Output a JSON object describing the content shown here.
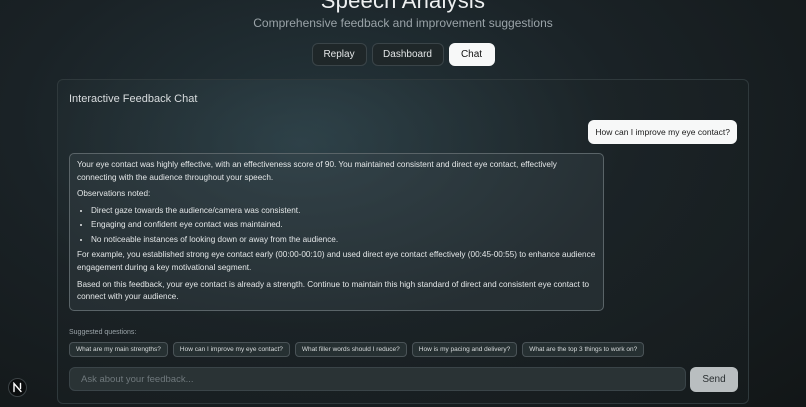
{
  "header": {
    "title": "Speech Analysis",
    "subtitle": "Comprehensive feedback and improvement suggestions"
  },
  "tabs": [
    {
      "label": "Replay",
      "active": false
    },
    {
      "label": "Dashboard",
      "active": false
    },
    {
      "label": "Chat",
      "active": true
    }
  ],
  "panel": {
    "title": "Interactive Feedback Chat",
    "user_message": "How can I improve my eye contact?",
    "assistant_message": {
      "p1": "Your eye contact was highly effective, with an effectiveness score of 90. You maintained consistent and direct eye contact, effectively connecting with the audience throughout your speech.",
      "p2": "Observations noted:",
      "bullets": [
        "Direct gaze towards the audience/camera was consistent.",
        "Engaging and confident eye contact was maintained.",
        "No noticeable instances of looking down or away from the audience."
      ],
      "p3": "For example, you established strong eye contact early (00:00-00:10) and used direct eye contact effectively (00:45-00:55) to enhance audience engagement during a key motivational segment.",
      "p4": "Based on this feedback, your eye contact is already a strength. Continue to maintain this high standard of direct and consistent eye contact to connect with your audience."
    },
    "suggested_label": "Suggested questions:",
    "suggestions": [
      "What are my main strengths?",
      "How can I improve my eye contact?",
      "What filler words should I reduce?",
      "How is my pacing and delivery?",
      "What are the top 3 things to work on?"
    ],
    "input_placeholder": "Ask about your feedback...",
    "send_label": "Send"
  },
  "logo": {
    "letter": "N"
  },
  "colors": {
    "background": "#121617",
    "active_tab": "#f7f8f8",
    "send_button": "#b9bec0"
  }
}
